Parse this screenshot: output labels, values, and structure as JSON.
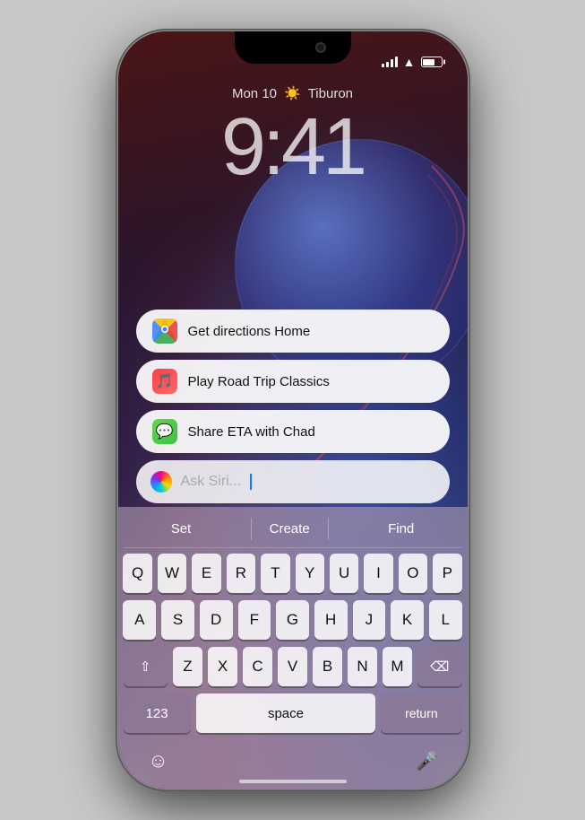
{
  "phone": {
    "status_bar": {
      "signal_label": "signal",
      "wifi_label": "wifi",
      "battery_label": "battery"
    },
    "clock": {
      "date": "Mon 10",
      "weather_icon": "☀️",
      "location": "Tiburon",
      "time": "9:41"
    },
    "suggestions": [
      {
        "id": "directions",
        "icon": "maps",
        "text": "Get directions Home"
      },
      {
        "id": "music",
        "icon": "music",
        "text": "Play Road Trip Classics"
      },
      {
        "id": "messages",
        "icon": "messages",
        "text": "Share ETA with Chad"
      }
    ],
    "siri_input": {
      "placeholder": "Ask Siri..."
    },
    "keyboard": {
      "suggestions": [
        "Set",
        "Create",
        "Find"
      ],
      "rows": [
        [
          "Q",
          "W",
          "E",
          "R",
          "T",
          "Y",
          "U",
          "I",
          "O",
          "P"
        ],
        [
          "A",
          "S",
          "D",
          "F",
          "G",
          "H",
          "J",
          "K",
          "L"
        ],
        [
          "⇧",
          "Z",
          "X",
          "C",
          "V",
          "B",
          "N",
          "M",
          "⌫"
        ],
        [
          "123",
          "space",
          "return"
        ]
      ]
    }
  }
}
